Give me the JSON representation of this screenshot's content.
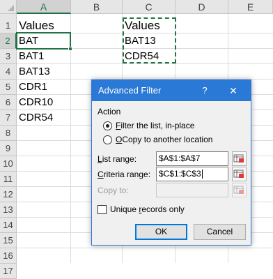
{
  "sheet": {
    "columns": [
      "A",
      "B",
      "C",
      "D",
      "E"
    ],
    "rows": [
      "1",
      "2",
      "3",
      "4",
      "5",
      "6",
      "7",
      "8",
      "9",
      "10",
      "11",
      "12",
      "13",
      "14",
      "15",
      "16",
      "17"
    ],
    "column_a": [
      "Values",
      "BAT",
      "BAT1",
      "BAT13",
      "CDR1",
      "CDR10",
      "CDR54"
    ],
    "column_c": [
      "Values",
      "BAT13",
      "CDR54"
    ]
  },
  "dialog": {
    "title": "Advanced Filter",
    "help_icon": "?",
    "close_icon": "✕",
    "action_label": "Action",
    "radio_filter": {
      "key": "F",
      "rest": "ilter the list, in-place",
      "selected": true
    },
    "radio_copy": {
      "pre": "",
      "key": "O",
      "rest": "Copy to another location",
      "selected": false
    },
    "list_range": {
      "key": "L",
      "rest": "ist range:",
      "value": "$A$1:$A$7"
    },
    "criteria_range": {
      "key": "C",
      "rest": "riteria range:",
      "value": "$C$1:$C$3"
    },
    "copy_to": {
      "label": "Copy to:",
      "value": "",
      "disabled": true
    },
    "unique": {
      "pre": "Unique ",
      "key": "r",
      "rest": "ecords only",
      "checked": false
    },
    "ok_label": "OK",
    "cancel_label": "Cancel",
    "accent_color": "#2b79d6"
  },
  "colors": {
    "selection_green": "#217346"
  }
}
